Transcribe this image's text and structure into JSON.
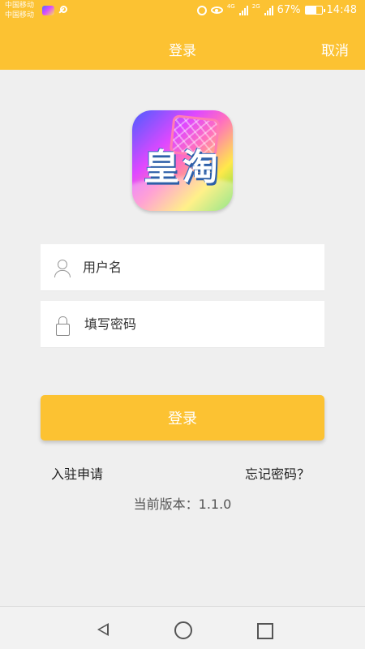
{
  "status": {
    "carrier_1": "中国移动",
    "carrier_2": "中国移动",
    "battery": "67%",
    "time": "14:48",
    "net_1": "4G",
    "net_2": "2G",
    "battery_fraction": 0.67
  },
  "header": {
    "title": "登录",
    "cancel": "取消",
    "color": "#fcc232"
  },
  "logo": {
    "text": "皇淘"
  },
  "form": {
    "username_placeholder": "用户名",
    "password_placeholder": "填写密码",
    "login_label": "登录"
  },
  "links": {
    "join": "入驻申请",
    "forgot": "忘记密码？"
  },
  "version": "当前版本：1.1.0",
  "icons": {
    "user": "user-icon",
    "lock": "lock-icon",
    "back": "back-triangle-icon",
    "home": "home-circle-icon",
    "recent": "recent-square-icon"
  }
}
